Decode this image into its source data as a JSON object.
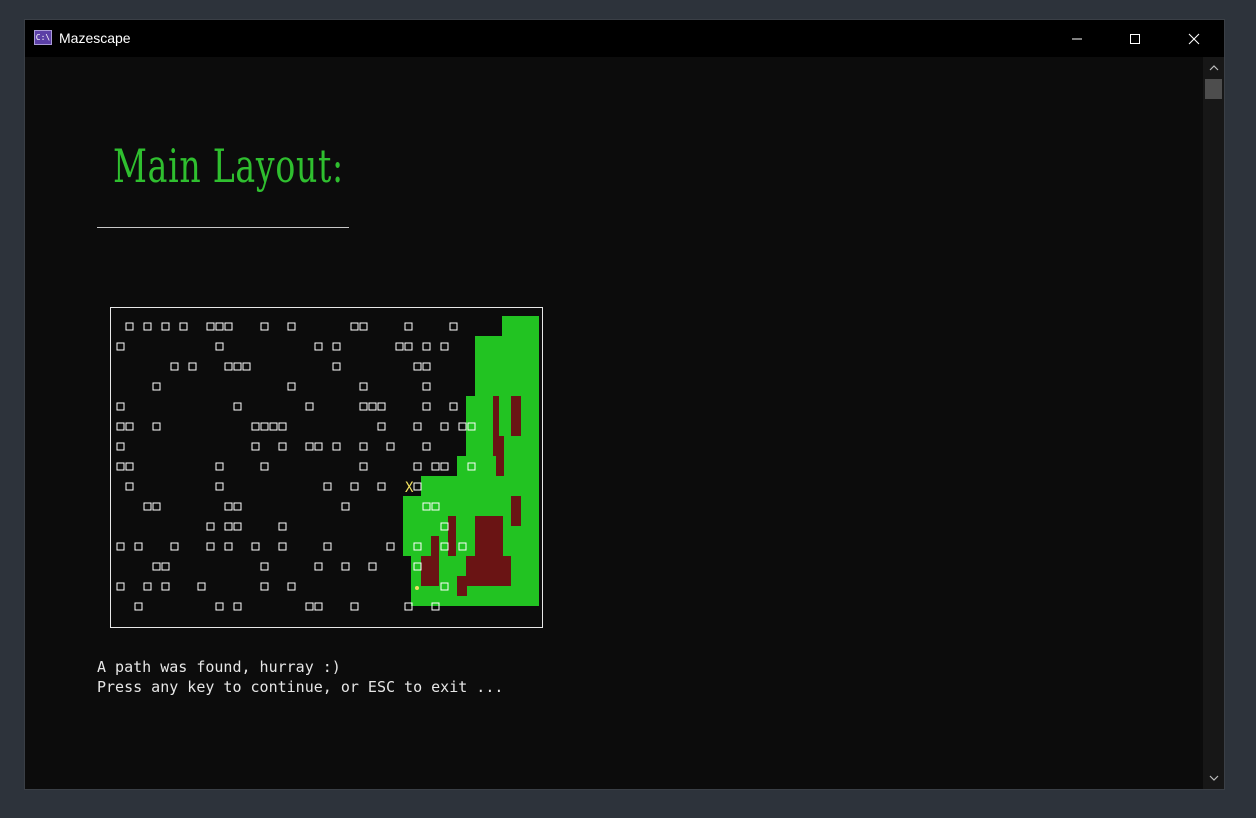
{
  "window": {
    "title": "Mazescape",
    "app_icon_text": "C:\\",
    "buttons": {
      "minimize": "minimize-icon",
      "maximize": "maximize-icon",
      "close": "close-icon"
    }
  },
  "heading": "Main Layout:",
  "maze": {
    "cols": 48,
    "rows": 15,
    "colors": {
      "wall": "#ffffff",
      "path": "#22c322",
      "dead_end": "#6a1414",
      "marker": "#f0e060",
      "background": "#0c0c0c"
    },
    "start_label": "X",
    "grid": [
      "................................................",
      "................................................",
      "................................................",
      "................................................",
      "................................................",
      "................................................",
      "................................................",
      "................................................",
      "................................................",
      "................................................",
      "................................................",
      "................................................",
      "................................................",
      "................................................",
      "................................................"
    ],
    "walls_ascii": [
      " # # # #  ###   #  #      ##    #    #  ",
      "#          #          # #      ## # #   ",
      "      # #   ###         #        ##     ",
      "    #              #       #      #     ",
      "#            #       #     ###    #  #  ",
      "##  #          ####          #   #  # ##",
      "#              #  #  ## #  #  #   #     ",
      "##         #    #          #     # ##  #",
      " #         #           #  #  #  X#      ",
      "   ##       ##           #        ##    ",
      "          # ##    #                 #  ",
      "# #   #   # #  #  #    #      #  #  # #",
      "    ##          #     #  #  #    #     ",
      "#  # #   #      #  #             .  #  ",
      "  #        # #       ##   #     #  #   "
    ]
  },
  "messages": {
    "line1": "A path was found, hurray :)",
    "line2": "Press any key to continue, or ESC to exit ..."
  }
}
